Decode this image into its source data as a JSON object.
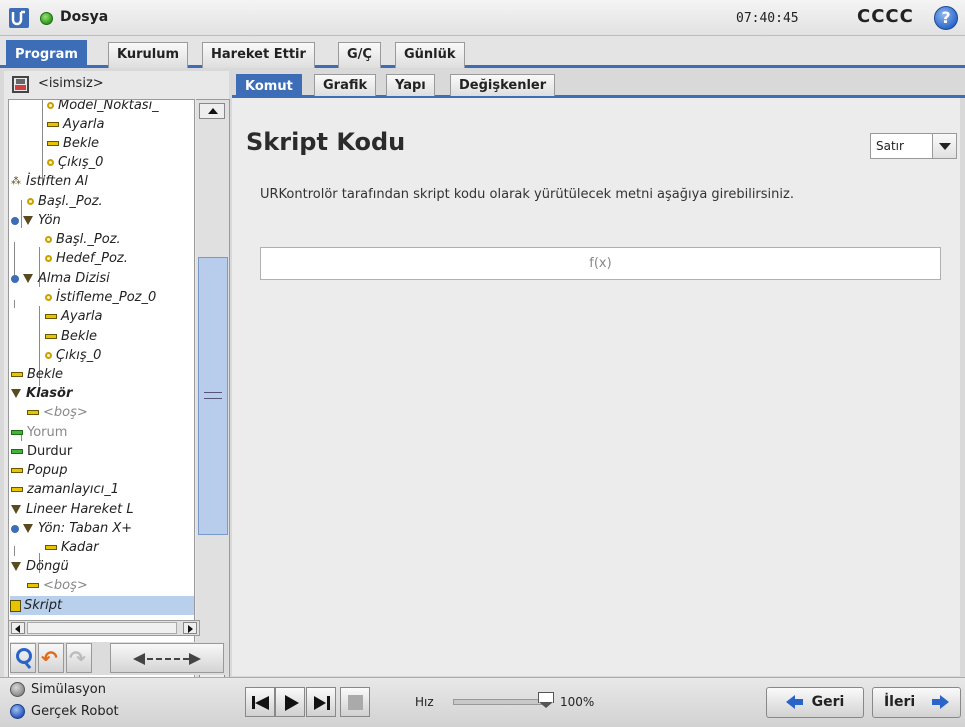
{
  "titlebar": {
    "app_name": "Dosya",
    "time": "07:40:45",
    "robot_name": "CCCC",
    "help_glyph": "?"
  },
  "main_tabs": [
    {
      "label": "Program",
      "active": true
    },
    {
      "label": "Kurulum",
      "active": false
    },
    {
      "label": "Hareket Ettir",
      "active": false
    },
    {
      "label": "G/Ç",
      "active": false
    },
    {
      "label": "Günlük",
      "active": false
    }
  ],
  "program": {
    "name": "<isimsiz>",
    "tree": [
      {
        "label": "Model_Noktası_",
        "icon": "waypoint-icon"
      },
      {
        "label": "Ayarla",
        "icon": "set-icon"
      },
      {
        "label": "Bekle",
        "icon": "wait-icon"
      },
      {
        "label": "Çıkış_0",
        "icon": "waypoint-icon"
      },
      {
        "label": "İstiften Al",
        "icon": "stack-icon"
      },
      {
        "label": "Başl._Poz.",
        "icon": "waypoint-icon"
      },
      {
        "label": "Yön",
        "icon": "direction-icon"
      },
      {
        "label": "Başl._Poz.",
        "icon": "waypoint-icon"
      },
      {
        "label": "Hedef_Poz.",
        "icon": "waypoint-icon"
      },
      {
        "label": "Alma Dizisi",
        "icon": "folder-icon"
      },
      {
        "label": "İstifleme_Poz_0",
        "icon": "waypoint-icon"
      },
      {
        "label": "Ayarla",
        "icon": "set-icon"
      },
      {
        "label": "Bekle",
        "icon": "wait-icon"
      },
      {
        "label": "Çıkış_0",
        "icon": "waypoint-icon"
      },
      {
        "label": "Bekle",
        "icon": "wait-icon"
      },
      {
        "label": "Klasör",
        "icon": "folder-icon"
      },
      {
        "label": "<boş>",
        "icon": "empty-icon"
      },
      {
        "label": "Yorum",
        "icon": "comment-icon"
      },
      {
        "label": "Durdur",
        "icon": "halt-icon"
      },
      {
        "label": "Popup",
        "icon": "popup-icon"
      },
      {
        "label": "zamanlayıcı_1",
        "icon": "timer-icon"
      },
      {
        "label": "Lineer Hareket L",
        "icon": "movel-icon"
      },
      {
        "label": "Yön: Taban X+",
        "icon": "direction-icon"
      },
      {
        "label": "Kadar",
        "icon": "until-icon"
      },
      {
        "label": "Döngü",
        "icon": "loop-icon"
      },
      {
        "label": "<boş>",
        "icon": "empty-icon"
      },
      {
        "label": "Skript",
        "icon": "script-icon",
        "selected": true
      }
    ]
  },
  "sub_tabs": [
    {
      "label": "Komut",
      "active": true
    },
    {
      "label": "Grafik",
      "active": false
    },
    {
      "label": "Yapı",
      "active": false
    },
    {
      "label": "Değişkenler",
      "active": false
    }
  ],
  "content": {
    "title": "Skript Kodu",
    "mode_select": "Satır",
    "description": "URKontrolör tarafından skript kodu olarak yürütülecek metni aşağıya girebilirsiniz.",
    "expression_placeholder": "f(x)"
  },
  "footer": {
    "mode_simulation": "Simülasyon",
    "mode_real": "Gerçek Robot",
    "speed_label": "Hız",
    "speed_value": "100%",
    "speed_level": 1.0,
    "back_label": "Geri",
    "next_label": "İleri"
  },
  "colors": {
    "accent": "#3c6db6",
    "selection": "#b8d0ec",
    "waypoint": "#c9a000"
  }
}
